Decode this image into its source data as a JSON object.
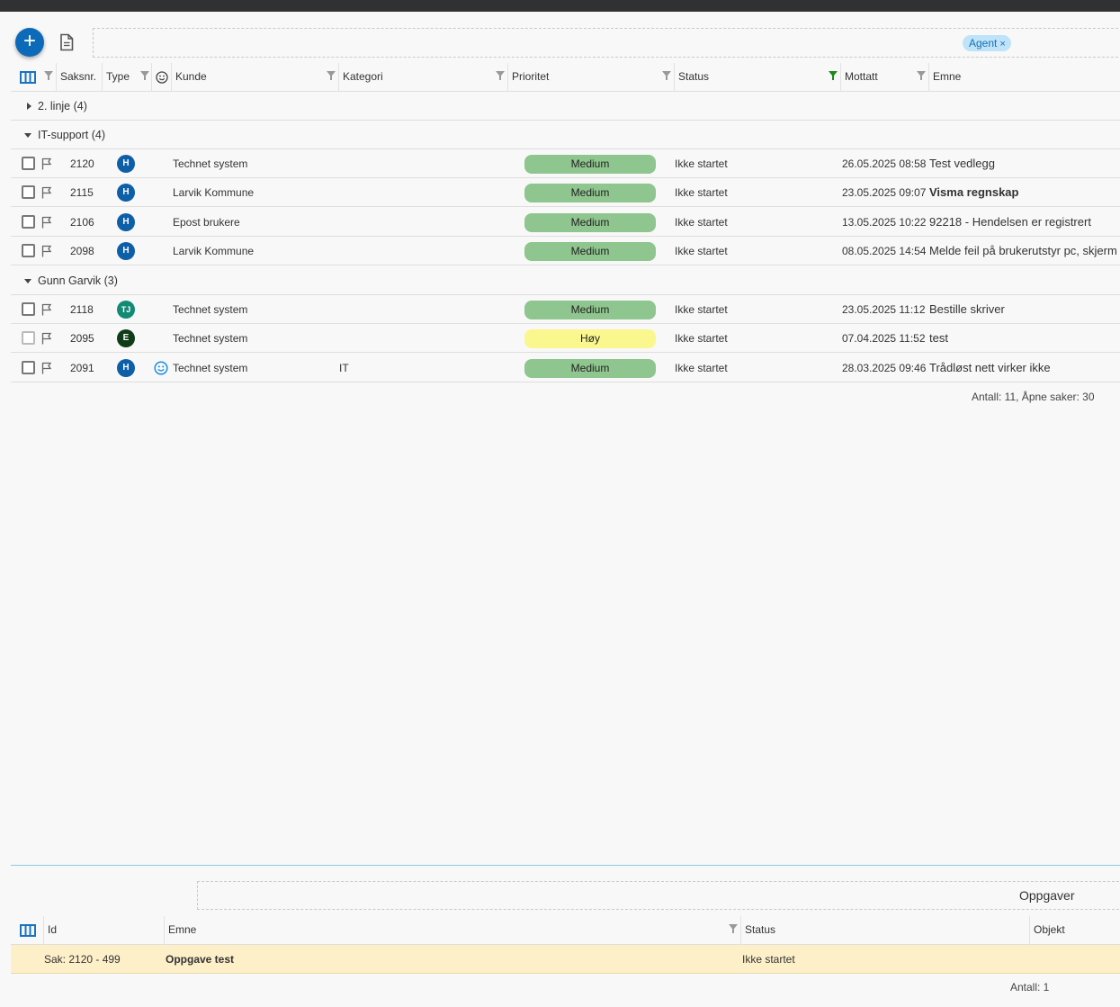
{
  "toolbar": {
    "filter_chip": "Agent",
    "chip_close": "×",
    "add_icon": "plus-icon",
    "doc_icon": "document-icon"
  },
  "columns": [
    {
      "key": "saksnr",
      "label": "Saksnr."
    },
    {
      "key": "type",
      "label": "Type"
    },
    {
      "key": "kunde",
      "label": "Kunde"
    },
    {
      "key": "kategori",
      "label": "Kategori"
    },
    {
      "key": "prioritet",
      "label": "Prioritet"
    },
    {
      "key": "status",
      "label": "Status"
    },
    {
      "key": "mottatt",
      "label": "Mottatt"
    },
    {
      "key": "emne",
      "label": "Emne"
    }
  ],
  "groups": [
    {
      "label": "2. linje (4)",
      "expanded": false
    },
    {
      "label": "IT-support (4)",
      "expanded": true
    },
    {
      "label": "Gunn Garvik (3)",
      "expanded": true
    }
  ],
  "rows": [
    {
      "nr": "2120",
      "avatar": "H",
      "avatar_color": "#0d5fa8",
      "kunde": "Technet system",
      "kategori": "",
      "prioritet": "Medium",
      "status": "Ikke startet",
      "mottatt": "26.05.2025 08:58",
      "emne": "Test vedlegg"
    },
    {
      "nr": "2115",
      "avatar": "H",
      "avatar_color": "#0d5fa8",
      "kunde": "Larvik Kommune",
      "kategori": "",
      "prioritet": "Medium",
      "status": "Ikke startet",
      "mottatt": "23.05.2025 09:07",
      "emne": "Visma regnskap"
    },
    {
      "nr": "2106",
      "avatar": "H",
      "avatar_color": "#0d5fa8",
      "kunde": "Epost brukere",
      "kategori": "",
      "prioritet": "Medium",
      "status": "Ikke startet",
      "mottatt": "13.05.2025 10:22",
      "emne": "92218 - Hendelsen er registrert"
    },
    {
      "nr": "2098",
      "avatar": "H",
      "avatar_color": "#0d5fa8",
      "kunde": "Larvik Kommune",
      "kategori": "",
      "prioritet": "Medium",
      "status": "Ikke startet",
      "mottatt": "08.05.2025 14:54",
      "emne": "Melde feil på brukerutstyr pc, skjerm"
    },
    {
      "nr": "2118",
      "avatar": "TJ",
      "avatar_color": "#138a74",
      "kunde": "Technet system",
      "kategori": "",
      "prioritet": "Medium",
      "status": "Ikke startet",
      "mottatt": "23.05.2025 11:12",
      "emne": "Bestille skriver"
    },
    {
      "nr": "2095",
      "avatar": "E",
      "avatar_color": "#0f3d17",
      "kunde": "Technet system",
      "kategori": "",
      "prioritet": "Høy",
      "status": "Ikke startet",
      "mottatt": "07.04.2025 11:52",
      "emne": "test"
    },
    {
      "nr": "2091",
      "avatar": "H",
      "avatar_color": "#0d5fa8",
      "kunde": "Technet system",
      "kategori": "IT",
      "prioritet": "Medium",
      "status": "Ikke startet",
      "mottatt": "28.03.2025 09:46",
      "emne": "Trådløst nett virker ikke"
    }
  ],
  "colors": {
    "medium": "#8fc58e",
    "hoy": "#fbf78f",
    "accent": "#0d6ab8",
    "filter_active": "#1b8a1b"
  },
  "summary": "Antall: 11, Åpne saker: 30",
  "tasks": {
    "title": "Oppgaver",
    "columns": {
      "id": "Id",
      "emne": "Emne",
      "status": "Status",
      "objekt": "Objekt"
    },
    "rows": [
      {
        "id": "Sak: 2120 - 499",
        "emne": "Oppgave test",
        "status": "Ikke startet",
        "objekt": ""
      }
    ],
    "count": "Antall: 1"
  }
}
